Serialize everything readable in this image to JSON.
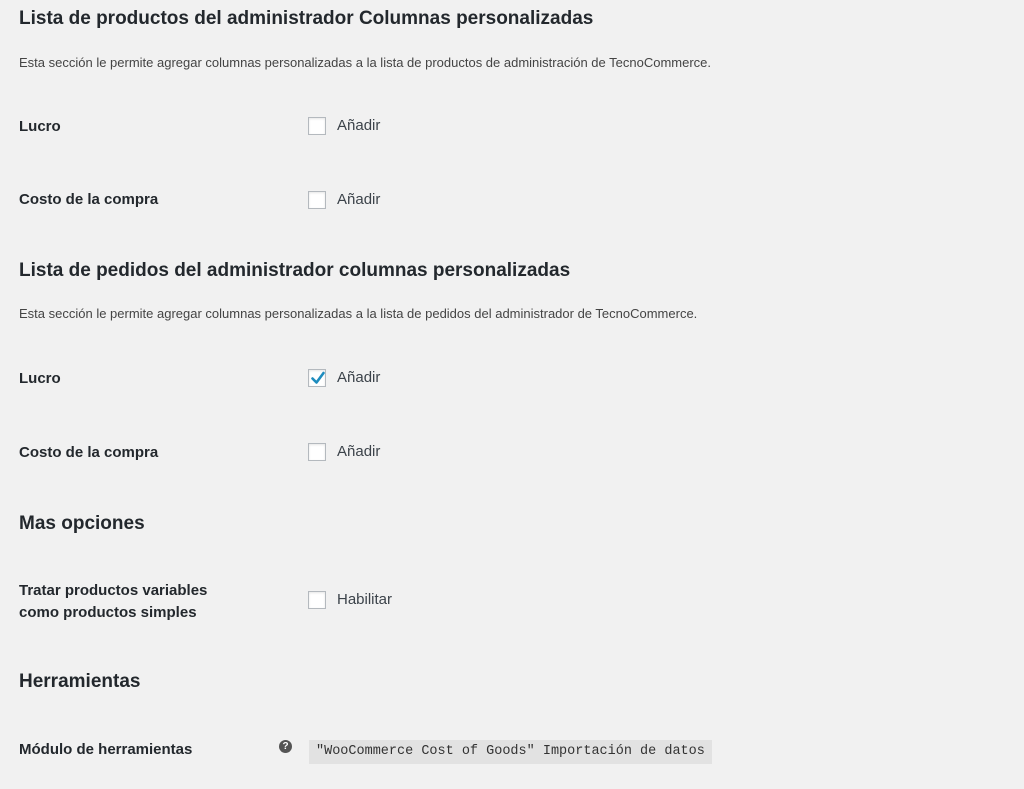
{
  "sections": [
    {
      "title": "Lista de productos del administrador Columnas personalizadas",
      "description": "Esta sección le permite agregar columnas personalizadas a la lista de productos de administración de TecnoCommerce.",
      "fields": [
        {
          "label": "Lucro",
          "option": "Añadir",
          "checked": false
        },
        {
          "label": "Costo de la compra",
          "option": "Añadir",
          "checked": false
        }
      ]
    },
    {
      "title": "Lista de pedidos del administrador columnas personalizadas",
      "description": "Esta sección le permite agregar columnas personalizadas a la lista de pedidos del administrador de TecnoCommerce.",
      "fields": [
        {
          "label": "Lucro",
          "option": "Añadir",
          "checked": true
        },
        {
          "label": "Costo de la compra",
          "option": "Añadir",
          "checked": false
        }
      ]
    },
    {
      "title": "Mas opciones",
      "fields": [
        {
          "label_line1": "Tratar productos variables",
          "label_line2": "como productos simples",
          "option": "Habilitar",
          "checked": false
        }
      ]
    },
    {
      "title": "Herramientas",
      "fields": [
        {
          "label": "Módulo de herramientas",
          "help_icon": "question-circle-icon",
          "help_glyph": "?",
          "code": "\"WooCommerce Cost of Goods\" Importación de datos"
        }
      ]
    }
  ],
  "colors": {
    "background": "#f1f1f1",
    "checkmark": "#1e8cbe",
    "code_background": "#e2e2e2"
  }
}
